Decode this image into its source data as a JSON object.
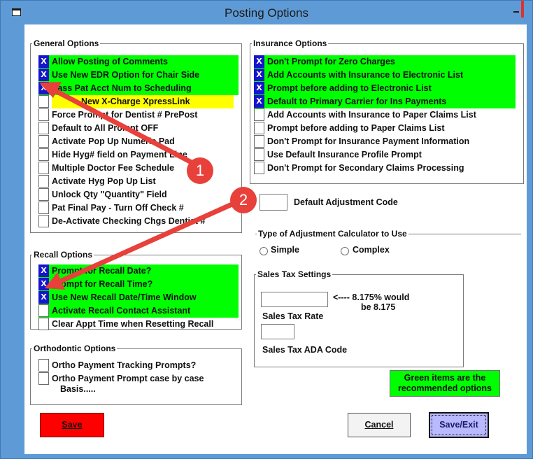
{
  "window": {
    "title": "Posting Options"
  },
  "general_options": {
    "legend": "General Options",
    "items": [
      {
        "label": "Allow Posting of Comments",
        "checked": true
      },
      {
        "label": "Use New EDR Option for Chair Side",
        "checked": true
      },
      {
        "label": "Pass Pat Acct Num to Scheduling",
        "checked": true
      },
      {
        "label": "New X-Charge XpressLink",
        "checked": false
      },
      {
        "label": "Force Prompt for Dentist # PrePost",
        "checked": false
      },
      {
        "label": "Default to All Prompt OFF",
        "checked": false
      },
      {
        "label": "Activate Pop Up Numeric Pad",
        "checked": false
      },
      {
        "label": "Hide Hyg# field on Payment Line",
        "checked": false
      },
      {
        "label": "Multiple Doctor Fee Schedule",
        "checked": false
      },
      {
        "label": "Activate Hyg Pop Up List",
        "checked": false
      },
      {
        "label": "Unlock Qty \"Quantity\" Field",
        "checked": false
      },
      {
        "label": "Pat Final Pay - Turn Off Check #",
        "checked": false
      },
      {
        "label": "De-Activate Checking Chgs Dentist #",
        "checked": false
      }
    ]
  },
  "recall_options": {
    "legend": "Recall Options",
    "items": [
      {
        "label": "Prompt for Recall Date?",
        "checked": true
      },
      {
        "label": "Prompt for Recall Time?",
        "checked": true
      },
      {
        "label": "Use New Recall Date/Time Window",
        "checked": true
      },
      {
        "label": "Activate Recall Contact Assistant",
        "checked": false
      },
      {
        "label": "Clear Appt Time when Resetting Recall",
        "checked": false
      }
    ]
  },
  "orthodontic_options": {
    "legend": "Orthodontic Options",
    "items": [
      {
        "label": "Ortho Payment Tracking Prompts?",
        "checked": false
      },
      {
        "label_line1": "Ortho Payment Prompt case by case",
        "label_line2": "Basis.....",
        "checked": false
      }
    ]
  },
  "insurance_options": {
    "legend": "Insurance Options",
    "items": [
      {
        "label": "Don't Prompt for Zero Charges",
        "checked": true
      },
      {
        "label": "Add Accounts with Insurance to Electronic List",
        "checked": true
      },
      {
        "label": "Prompt before adding to Electronic List",
        "checked": true
      },
      {
        "label": "Default to Primary Carrier for Ins Payments",
        "checked": true
      },
      {
        "label": "Add Accounts with Insurance to Paper Claims List",
        "checked": false
      },
      {
        "label": "Prompt before adding to Paper Claims List",
        "checked": false
      },
      {
        "label": "Don't Prompt for Insurance Payment Information",
        "checked": false
      },
      {
        "label": "Use Default Insurance Profile Prompt",
        "checked": false
      },
      {
        "label": "Don't Prompt for Secondary Claims Processing",
        "checked": false
      }
    ]
  },
  "default_adjustment": {
    "label": "Default Adjustment Code",
    "value": ""
  },
  "adjustment_calculator": {
    "legend": "Type of Adjustment Calculator to Use",
    "options": [
      "Simple",
      "Complex"
    ]
  },
  "sales_tax": {
    "legend": "Sales Tax Settings",
    "rate_value": "",
    "rate_hint_line1": "<---- 8.175% would",
    "rate_hint_line2": "be 8.175",
    "rate_label": "Sales Tax Rate",
    "ada_value": "",
    "ada_label": "Sales Tax ADA Code"
  },
  "legend_note": {
    "line1": "Green items are the",
    "line2": "recommended options"
  },
  "buttons": {
    "save": "Save",
    "cancel": "Cancel",
    "save_exit": "Save/Exit"
  },
  "callouts": [
    "1",
    "2"
  ],
  "colors": {
    "recommended": "#00ff00",
    "highlight": "#ffff00",
    "checked": "#1515cc",
    "save_button": "#ff0000",
    "title_bar": "#5e9bd6",
    "arrow": "#e8403a"
  }
}
